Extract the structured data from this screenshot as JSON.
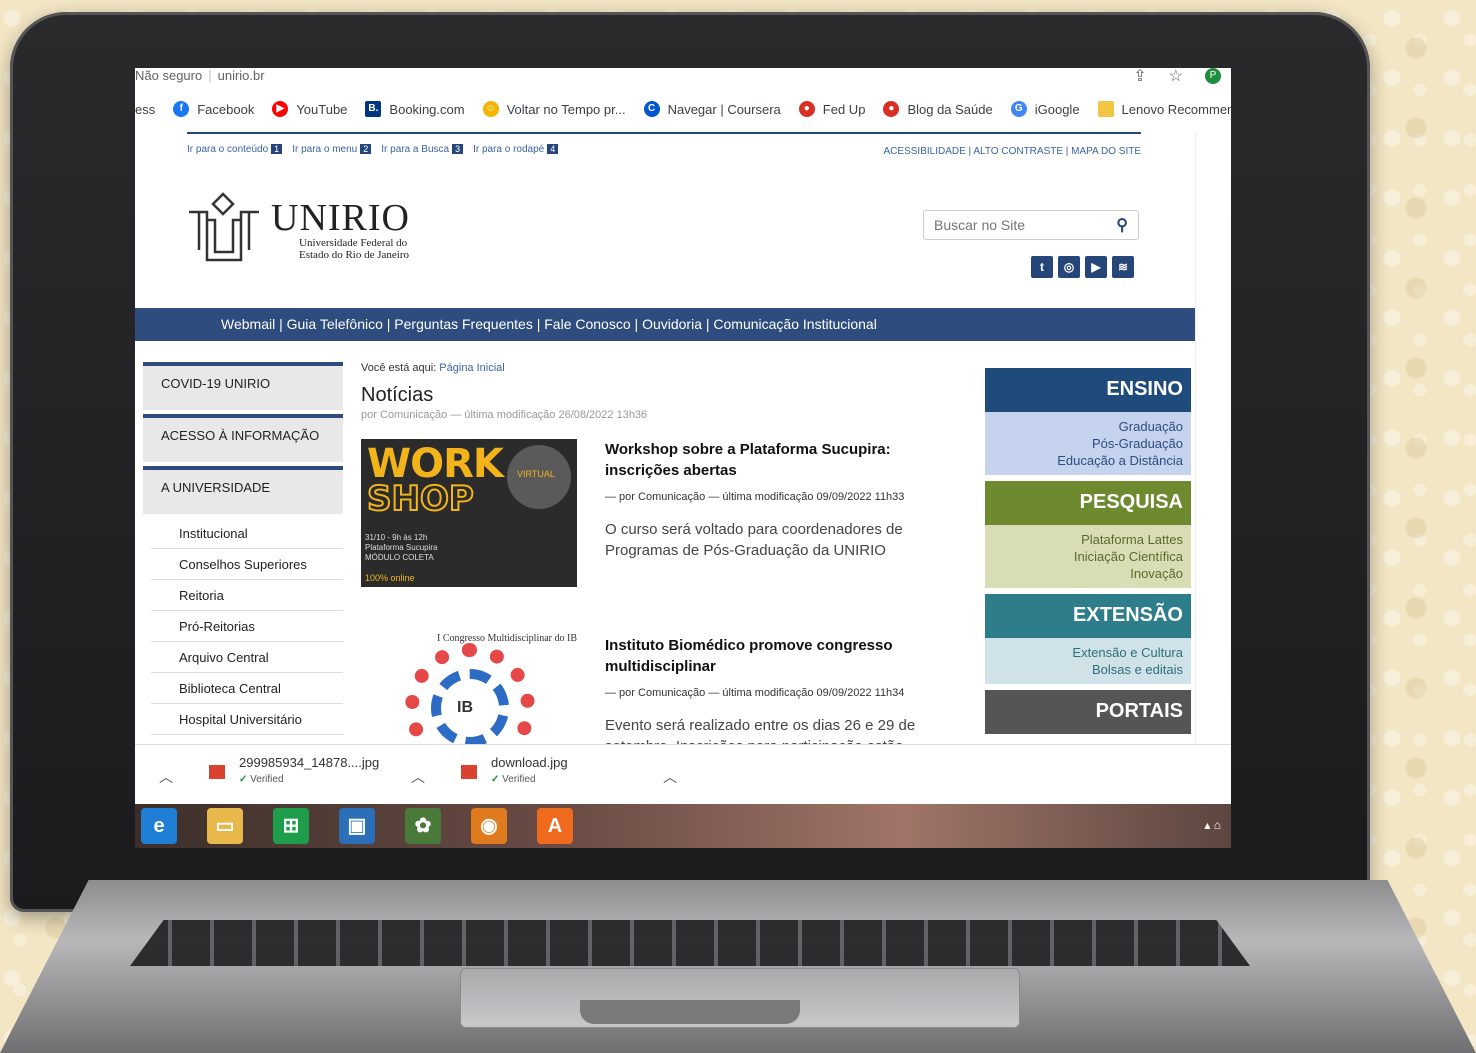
{
  "browser": {
    "security": "Não seguro",
    "url": "unirio.br",
    "profile_initial": "P",
    "bookmarks": [
      {
        "label": "ess",
        "icon": "",
        "color": ""
      },
      {
        "label": "Facebook",
        "icon": "f",
        "color": "#1877f2"
      },
      {
        "label": "YouTube",
        "icon": "▶",
        "color": "#ff0000"
      },
      {
        "label": "Booking.com",
        "icon": "B.",
        "color": "#003580"
      },
      {
        "label": "Voltar no Tempo pr...",
        "icon": "☺",
        "color": "#f4b400"
      },
      {
        "label": "Navegar | Coursera",
        "icon": "C",
        "color": "#0056d2"
      },
      {
        "label": "Fed Up",
        "icon": "●",
        "color": "#d93025"
      },
      {
        "label": "Blog da Saúde",
        "icon": "●",
        "color": "#d93025"
      },
      {
        "label": "iGoogle",
        "icon": "G",
        "color": "#4285f4"
      },
      {
        "label": "Lenovo Recommen",
        "icon": "",
        "color": "#f4c542"
      }
    ]
  },
  "page": {
    "skiplinks": [
      {
        "label": "Ir para o conteúdo",
        "num": "1"
      },
      {
        "label": "Ir para o menu",
        "num": "2"
      },
      {
        "label": "Ir para a Busca",
        "num": "3"
      },
      {
        "label": "Ir para o rodapé",
        "num": "4"
      }
    ],
    "toplinks": "ACESSIBILIDADE | ALTO CONTRASTE | MAPA DO SITE",
    "logo": {
      "title": "UNIRIO",
      "sub1": "Universidade Federal do",
      "sub2": "Estado do Rio de Janeiro"
    },
    "search": {
      "placeholder": "Buscar no Site"
    },
    "social": [
      "t",
      "◎",
      "▶",
      "≋"
    ],
    "nav": [
      "Webmail",
      "Guia Telefônico",
      "Perguntas Frequentes",
      "Fale Conosco",
      "Ouvidoria",
      "Comunicação Institucional"
    ],
    "sidebar": {
      "heads": [
        "COVID-19 UNIRIO",
        "ACESSO À INFORMAÇÃO",
        "A UNIVERSIDADE"
      ],
      "items": [
        "Institucional",
        "Conselhos Superiores",
        "Reitoria",
        "Pró-Reitorias",
        "Arquivo Central",
        "Biblioteca Central",
        "Hospital Universitário"
      ]
    },
    "breadcrumb": {
      "prefix": "Você está aqui:",
      "link": "Página Inicial"
    },
    "title": "Notícias",
    "meta": "por Comunicação — última modificação 26/08/2022 13h36",
    "news": [
      {
        "headline": "Workshop sobre a Plataforma Sucupira: inscrições abertas",
        "byline": "— por Comunicação — última modificação 09/09/2022 11h33",
        "desc": "O curso será voltado para coordenadores de Programas de Pós-Graduação da UNIRIO",
        "thumb": {
          "w1": "WORK",
          "w2": "SHOP",
          "small1": "31/10 - 9h às 12h",
          "small2": "Plataforma Sucupira",
          "small3": "MÓDULO COLETA",
          "bar": "100% online",
          "badge": "VIRTUAL"
        }
      },
      {
        "headline": "Instituto Biomédico promove congresso multidisciplinar",
        "byline": "— por Comunicação — última modificação 09/09/2022 11h34",
        "desc": "Evento será realizado entre os dias 26 e 29 de setembro. Inscrições para participação estão",
        "thumb": {
          "label": "I Congresso Multidisciplinar do IB",
          "center": "IB"
        }
      }
    ],
    "right": {
      "ensino": {
        "title": "ENSINO",
        "links": [
          "Graduação",
          "Pós-Graduação",
          "Educação a Distância"
        ]
      },
      "pesquisa": {
        "title": "PESQUISA",
        "links": [
          "Plataforma Lattes",
          "Iniciação Científica",
          "Inovação"
        ]
      },
      "extensao": {
        "title": "EXTENSÃO",
        "links": [
          "Extensão e Cultura",
          "Bolsas e editais"
        ]
      },
      "portais": {
        "title": "PORTAIS"
      }
    }
  },
  "downloads": [
    {
      "name": "299985934_14878....jpg",
      "status": "Verified"
    },
    {
      "name": "download.jpg",
      "status": "Verified"
    }
  ],
  "taskbar": {
    "icons": [
      {
        "name": "ie-icon",
        "glyph": "e",
        "color": "#1f7fd6"
      },
      {
        "name": "explorer-icon",
        "glyph": "▭",
        "color": "#e8b84a"
      },
      {
        "name": "store-icon",
        "glyph": "⊞",
        "color": "#1e9e4a"
      },
      {
        "name": "desktop-icon",
        "glyph": "▣",
        "color": "#2a6fb8"
      },
      {
        "name": "app-icon",
        "glyph": "✿",
        "color": "#4a7a3a"
      },
      {
        "name": "browser-icon",
        "glyph": "◉",
        "color": "#e07a1e"
      },
      {
        "name": "avast-icon",
        "glyph": "A",
        "color": "#f06a1e"
      }
    ],
    "tray": "▴ ⌂"
  }
}
